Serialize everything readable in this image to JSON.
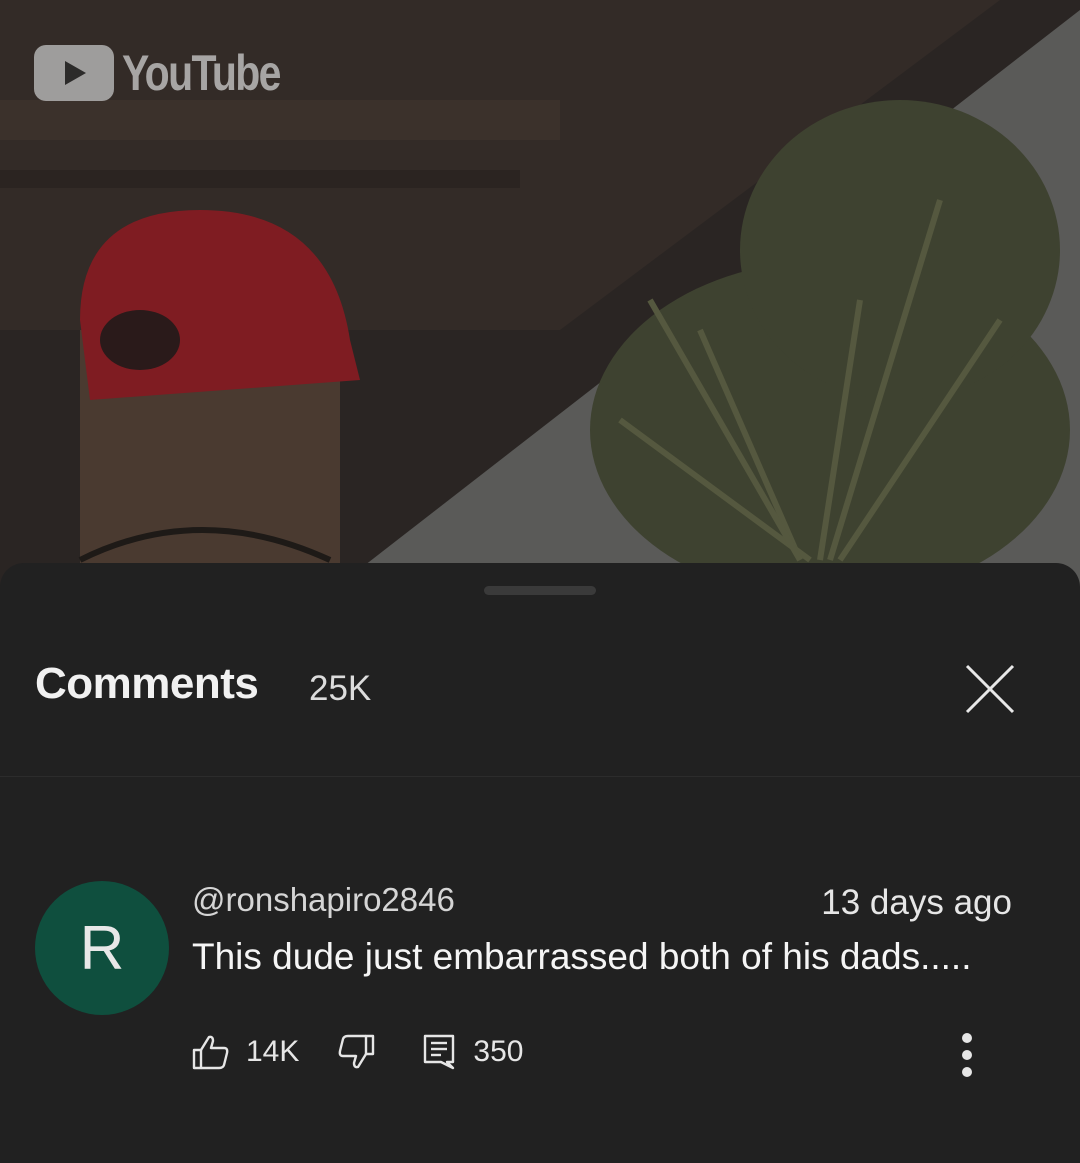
{
  "video": {
    "logo_text": "YouTube"
  },
  "comments_panel": {
    "title": "Comments",
    "count": "25K"
  },
  "comment": {
    "avatar_letter": "R",
    "avatar_color": "#0f4f3e",
    "author": "@ronshapiro2846",
    "time": "13 days ago",
    "text": "This dude just embarrassed both of his dads.....",
    "likes": "14K",
    "replies": "350"
  },
  "icons": [
    "youtube-play-icon",
    "close-icon",
    "thumbs-up-icon",
    "thumbs-down-icon",
    "reply-icon",
    "more-vertical-icon"
  ]
}
